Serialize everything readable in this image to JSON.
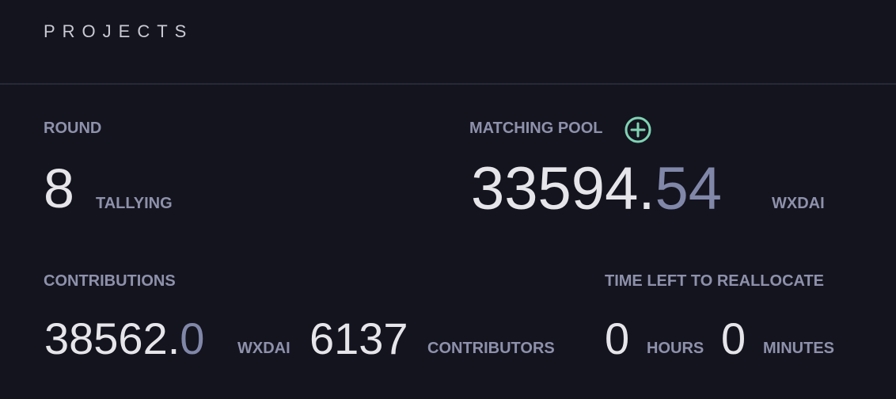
{
  "header": {
    "title": "PROJECTS"
  },
  "round": {
    "label": "ROUND",
    "value": "8",
    "status": "TALLYING"
  },
  "matching_pool": {
    "label": "MATCHING POOL",
    "amount_whole": "33594.",
    "amount_fraction": "54",
    "unit": "WXDAI",
    "add_icon": "plus-circle-icon"
  },
  "contributions": {
    "label": "CONTRIBUTIONS",
    "amount_whole": "38562.",
    "amount_fraction": "0",
    "unit": "WXDAI",
    "contributors_count": "6137",
    "contributors_label": "CONTRIBUTORS"
  },
  "time_left": {
    "label": "TIME LEFT TO REALLOCATE",
    "hours": "0",
    "hours_label": "HOURS",
    "minutes": "0",
    "minutes_label": "MINUTES"
  },
  "colors": {
    "background": "#14141f",
    "label": "#8e91ab",
    "value": "#e6e6ea",
    "fraction": "#8187a8",
    "accent": "#7fd3b3"
  }
}
